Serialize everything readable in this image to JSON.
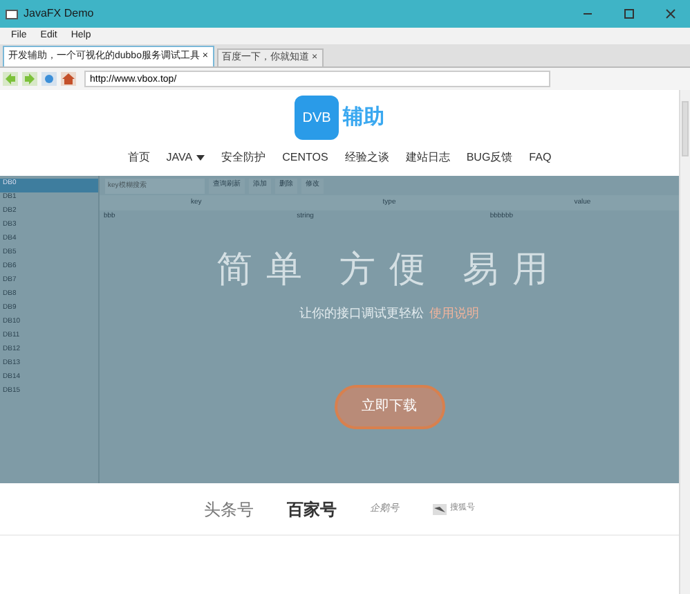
{
  "window": {
    "title": "JavaFX Demo"
  },
  "menu": [
    "File",
    "Edit",
    "Help"
  ],
  "tabs": [
    {
      "label": "开发辅助，一个可视化的dubbo服务调试工具 ×",
      "selected": true
    },
    {
      "label": "百度一下，你就知道 ×",
      "selected": false
    }
  ],
  "address_bar": {
    "value": "http://www.vbox.top/"
  },
  "page": {
    "logo": {
      "badge": "DVB",
      "text": "辅助"
    },
    "nav": [
      {
        "label": "首页",
        "dropdown": false
      },
      {
        "label": "JAVA",
        "dropdown": true
      },
      {
        "label": "安全防护",
        "dropdown": false
      },
      {
        "label": "CENTOS",
        "dropdown": false
      },
      {
        "label": "经验之谈",
        "dropdown": false
      },
      {
        "label": "建站日志",
        "dropdown": false
      },
      {
        "label": "BUG反馈",
        "dropdown": false
      },
      {
        "label": "FAQ",
        "dropdown": false
      }
    ],
    "app_preview": {
      "databases": [
        {
          "label": "DB0",
          "selected": true
        },
        {
          "label": "DB1",
          "selected": false
        },
        {
          "label": "DB2",
          "selected": false
        },
        {
          "label": "DB3",
          "selected": false
        },
        {
          "label": "DB4",
          "selected": false
        },
        {
          "label": "DB5",
          "selected": false
        },
        {
          "label": "DB6",
          "selected": false
        },
        {
          "label": "DB7",
          "selected": false
        },
        {
          "label": "DB8",
          "selected": false
        },
        {
          "label": "DB9",
          "selected": false
        },
        {
          "label": "DB10",
          "selected": false
        },
        {
          "label": "DB11",
          "selected": false
        },
        {
          "label": "DB12",
          "selected": false
        },
        {
          "label": "DB13",
          "selected": false
        },
        {
          "label": "DB14",
          "selected": false
        },
        {
          "label": "DB15",
          "selected": false
        }
      ],
      "search_placeholder": "key模糊搜索",
      "buttons": [
        "查询刷新",
        "添加",
        "删除",
        "修改"
      ],
      "columns": [
        "key",
        "type",
        "value"
      ],
      "rows": [
        [
          "bbb",
          "string",
          "bbbbbb"
        ]
      ]
    },
    "hero_title": "简单 方便 易用",
    "hero_subtitle": "让你的接口调试更轻松",
    "hero_link": "使用说明",
    "download_button": "立即下载",
    "partners": [
      {
        "label": "头条号",
        "kind": "plain"
      },
      {
        "label": "百家号",
        "kind": "bold"
      },
      {
        "label": "企鹅号",
        "kind": "script"
      },
      {
        "label": "搜狐号",
        "kind": "icon"
      }
    ]
  }
}
